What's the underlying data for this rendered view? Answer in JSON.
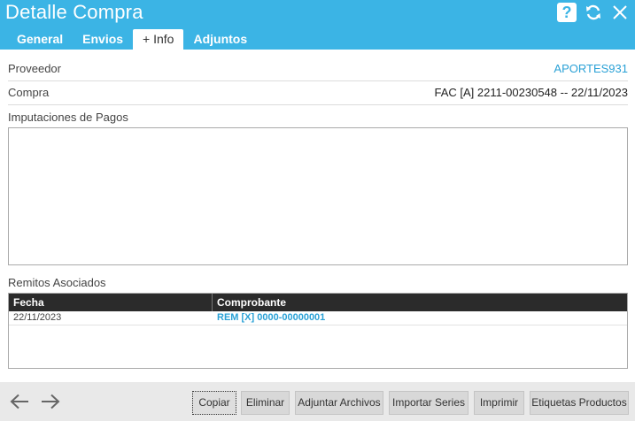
{
  "header": {
    "title": "Detalle Compra",
    "icons": [
      "help-icon",
      "refresh-icon",
      "close-icon"
    ],
    "help_glyph": "?",
    "color": "#3bb4e5"
  },
  "tabs": [
    {
      "label": "General",
      "active": false
    },
    {
      "label": "Envios",
      "active": false
    },
    {
      "label": "+ Info",
      "active": true
    },
    {
      "label": "Adjuntos",
      "active": false
    }
  ],
  "fields": {
    "proveedor": {
      "label": "Proveedor",
      "value": "APORTES931"
    },
    "compra": {
      "label": "Compra",
      "value": "FAC [A] 2211-00230548 -- 22/11/2023"
    }
  },
  "imputaciones": {
    "label": "Imputaciones de Pagos"
  },
  "remitos": {
    "label": "Remitos Asociados",
    "columns": [
      "Fecha",
      "Comprobante"
    ],
    "rows": [
      {
        "fecha": "22/11/2023",
        "comprobante": "REM [X] 0000-00000001"
      }
    ]
  },
  "footer": {
    "nav_icons": [
      "arrow-left-icon",
      "arrow-right-icon"
    ],
    "buttons": [
      "Copiar",
      "Eliminar",
      "Adjuntar Archivos",
      "Importar Series",
      "Imprimir",
      "Etiquetas Productos"
    ]
  }
}
